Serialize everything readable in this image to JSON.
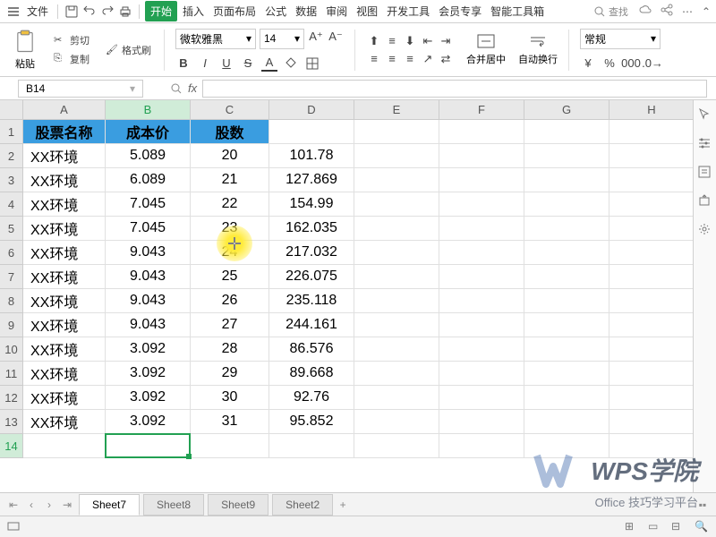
{
  "menu": {
    "file": "文件",
    "tabs": [
      "开始",
      "插入",
      "页面布局",
      "公式",
      "数据",
      "审阅",
      "视图",
      "开发工具",
      "会员专享",
      "智能工具箱"
    ],
    "active_tab": 0,
    "search": "查找"
  },
  "ribbon": {
    "paste": "粘贴",
    "cut": "剪切",
    "copy": "复制",
    "format_painter": "格式刷",
    "font_name": "微软雅黑",
    "font_size": "14",
    "merge": "合并居中",
    "wrap": "自动换行",
    "number_format": "常规",
    "currency": "¥",
    "percent": "%"
  },
  "name_box": "B14",
  "fx_label": "fx",
  "columns": [
    "A",
    "B",
    "C",
    "D",
    "E",
    "F",
    "G",
    "H"
  ],
  "headers": {
    "A": "股票名称",
    "B": "成本价",
    "C": "股数"
  },
  "rows": [
    {
      "A": "XX环境",
      "B": "5.089",
      "C": "20",
      "D": "101.78"
    },
    {
      "A": "XX环境",
      "B": "6.089",
      "C": "21",
      "D": "127.869"
    },
    {
      "A": "XX环境",
      "B": "7.045",
      "C": "22",
      "D": "154.99"
    },
    {
      "A": "XX环境",
      "B": "7.045",
      "C": "23",
      "D": "162.035"
    },
    {
      "A": "XX环境",
      "B": "9.043",
      "C": "24",
      "D": "217.032"
    },
    {
      "A": "XX环境",
      "B": "9.043",
      "C": "25",
      "D": "226.075"
    },
    {
      "A": "XX环境",
      "B": "9.043",
      "C": "26",
      "D": "235.118"
    },
    {
      "A": "XX环境",
      "B": "9.043",
      "C": "27",
      "D": "244.161"
    },
    {
      "A": "XX环境",
      "B": "3.092",
      "C": "28",
      "D": "86.576"
    },
    {
      "A": "XX环境",
      "B": "3.092",
      "C": "29",
      "D": "89.668"
    },
    {
      "A": "XX环境",
      "B": "3.092",
      "C": "30",
      "D": "92.76"
    },
    {
      "A": "XX环境",
      "B": "3.092",
      "C": "31",
      "D": "95.852"
    }
  ],
  "sheets": [
    "Sheet7",
    "Sheet8",
    "Sheet9",
    "Sheet2"
  ],
  "active_sheet": 0,
  "fmt": {
    "B": "B",
    "I": "I",
    "U": "U",
    "S": "S",
    "A": "A"
  },
  "watermark": {
    "brand": "WPS学院",
    "sub": "Office 技巧学习平台"
  }
}
